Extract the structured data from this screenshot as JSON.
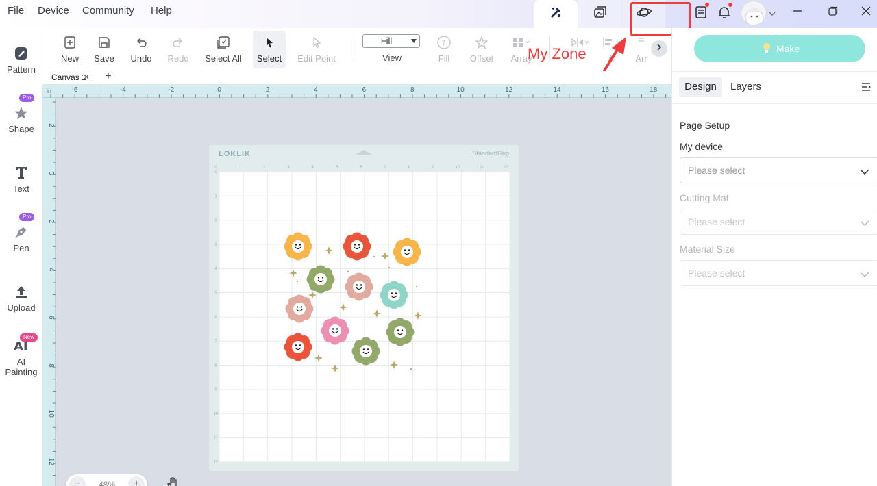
{
  "menubar": {
    "items": [
      "File",
      "Device",
      "Community",
      "Help"
    ]
  },
  "annotation": {
    "label": "My Zone",
    "color": "#ee3b3b"
  },
  "sidebar": {
    "items": [
      {
        "label": "Pattern",
        "icon": "palette-icon"
      },
      {
        "label": "Shape",
        "icon": "shape-star-icon",
        "badge": "Pro"
      },
      {
        "label": "Text",
        "icon": "text-t-icon"
      },
      {
        "label": "Pen",
        "icon": "pen-nib-icon",
        "badge": "Pro"
      },
      {
        "label": "Upload",
        "icon": "upload-icon"
      },
      {
        "label": "AI",
        "label2": "Painting",
        "icon": "ai-painting-icon",
        "badge": "New"
      }
    ],
    "pro_color": "#9b5de5",
    "new_color": "#e9468a"
  },
  "toolbar": {
    "new": "New",
    "save": "Save",
    "undo": "Undo",
    "redo": "Redo",
    "select_all": "Select All",
    "select": "Select",
    "edit_point": "Edit Point",
    "fill_value": "Fill",
    "view": "View",
    "fill": "Fill",
    "offset": "Offset",
    "array": "Array",
    "align": "Al",
    "arrange": "Arr"
  },
  "canvas_tabs": {
    "active": "Canvas 1",
    "add": "+"
  },
  "rulers": {
    "unit": "in",
    "top_ticks": [
      "-6",
      "-4",
      "-2",
      "0",
      "2",
      "4",
      "6",
      "8",
      "10",
      "12",
      "14",
      "16",
      "18"
    ],
    "left_ticks": [
      "2",
      "0",
      "2",
      "4",
      "6",
      "8",
      "10",
      "12"
    ]
  },
  "mat": {
    "brand": "LOKLIK",
    "type": "StandardGrip",
    "top_ticks": [
      "0",
      "1",
      "2",
      "3",
      "4",
      "5",
      "6",
      "7",
      "8",
      "9",
      "10",
      "11",
      "12"
    ],
    "left_ticks": [
      "0",
      "1",
      "2",
      "3",
      "4",
      "5",
      "6",
      "7",
      "8",
      "9",
      "10",
      "11",
      "12"
    ]
  },
  "design": {
    "flower_colors": [
      "#f7b54a",
      "#e8553b",
      "#f7b54a",
      "#93a96a",
      "#e2aba0",
      "#8fd6c8",
      "#e2aba0",
      "#ec8fb0",
      "#93a96a",
      "#e8553b",
      "#93a96a"
    ]
  },
  "zoom": {
    "value": "48%"
  },
  "right_panel": {
    "make": "Make",
    "tab_design": "Design",
    "tab_layers": "Layers",
    "page_setup": "Page Setup",
    "my_device": "My device",
    "cutting_mat": "Cutting Mat",
    "material_size": "Material Size",
    "placeholder": "Please select"
  }
}
